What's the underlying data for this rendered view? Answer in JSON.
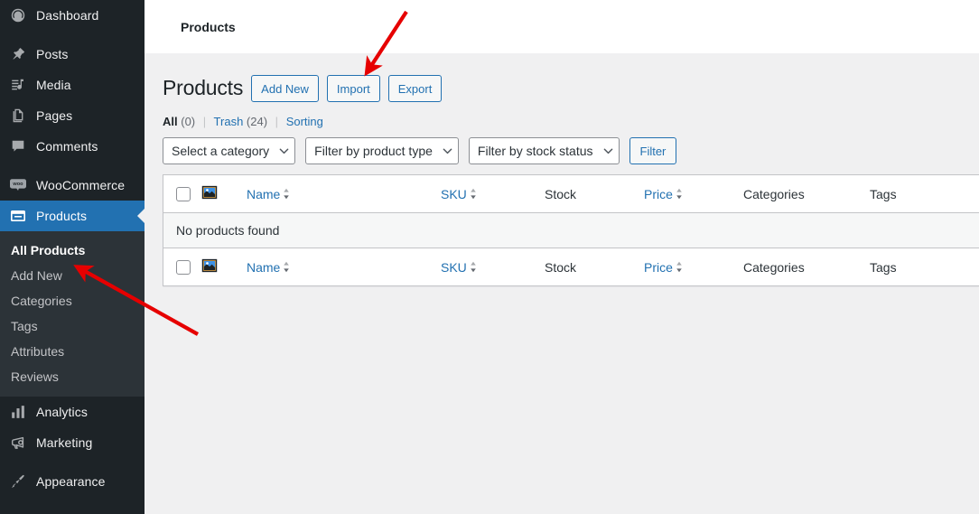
{
  "sidebar": {
    "items": [
      {
        "label": "Dashboard",
        "icon": "dashboard-icon",
        "name": "sidebar-item-dashboard",
        "current": false,
        "separator_after": true
      },
      {
        "label": "Posts",
        "icon": "pin-icon",
        "name": "sidebar-item-posts",
        "current": false,
        "separator_after": false
      },
      {
        "label": "Media",
        "icon": "media-icon",
        "name": "sidebar-item-media",
        "current": false,
        "separator_after": false
      },
      {
        "label": "Pages",
        "icon": "pages-icon",
        "name": "sidebar-item-pages",
        "current": false,
        "separator_after": false
      },
      {
        "label": "Comments",
        "icon": "comment-icon",
        "name": "sidebar-item-comments",
        "current": false,
        "separator_after": true
      },
      {
        "label": "WooCommerce",
        "icon": "woocommerce-icon",
        "name": "sidebar-item-woocommerce",
        "current": false,
        "separator_after": false
      },
      {
        "label": "Products",
        "icon": "products-icon",
        "name": "sidebar-item-products",
        "current": true,
        "separator_after": false
      }
    ],
    "submenu": [
      {
        "label": "All Products",
        "name": "submenu-item-all-products",
        "active": true
      },
      {
        "label": "Add New",
        "name": "submenu-item-add-new",
        "active": false
      },
      {
        "label": "Categories",
        "name": "submenu-item-categories",
        "active": false
      },
      {
        "label": "Tags",
        "name": "submenu-item-tags",
        "active": false
      },
      {
        "label": "Attributes",
        "name": "submenu-item-attributes",
        "active": false
      },
      {
        "label": "Reviews",
        "name": "submenu-item-reviews",
        "active": false
      }
    ],
    "items_after": [
      {
        "label": "Analytics",
        "icon": "bar-chart-icon",
        "name": "sidebar-item-analytics",
        "current": false,
        "separator_after": false
      },
      {
        "label": "Marketing",
        "icon": "megaphone-icon",
        "name": "sidebar-item-marketing",
        "current": false,
        "separator_after": true
      },
      {
        "label": "Appearance",
        "icon": "paintbrush-icon",
        "name": "sidebar-item-appearance",
        "current": false,
        "separator_after": false
      }
    ],
    "colors": {
      "background": "#1d2327",
      "submenu_background": "#2c3338",
      "current_background": "#2271b1"
    }
  },
  "topbar": {
    "breadcrumb": "Products"
  },
  "header": {
    "page_title": "Products",
    "actions": [
      {
        "label": "Add New",
        "name": "add-new-button"
      },
      {
        "label": "Import",
        "name": "import-button"
      },
      {
        "label": "Export",
        "name": "export-button"
      }
    ]
  },
  "views": {
    "all_label": "All",
    "all_count": "(0)",
    "trash_label": "Trash",
    "trash_count": "(24)",
    "sorting_label": "Sorting",
    "separator": "|"
  },
  "filters": {
    "category_select": "Select a category",
    "product_type_select": "Filter by product type",
    "stock_status_select": "Filter by stock status",
    "filter_button": "Filter"
  },
  "table": {
    "columns": [
      {
        "label": "",
        "name": "column-checkbox",
        "sortable": false,
        "type": "checkbox"
      },
      {
        "label": "",
        "name": "column-thumbnail",
        "sortable": false,
        "type": "thumbnail"
      },
      {
        "label": "Name",
        "name": "column-name",
        "sortable": true,
        "type": "text"
      },
      {
        "label": "SKU",
        "name": "column-sku",
        "sortable": true,
        "type": "text"
      },
      {
        "label": "Stock",
        "name": "column-stock",
        "sortable": false,
        "type": "text"
      },
      {
        "label": "Price",
        "name": "column-price",
        "sortable": true,
        "type": "text"
      },
      {
        "label": "Categories",
        "name": "column-categories",
        "sortable": false,
        "type": "text"
      },
      {
        "label": "Tags",
        "name": "column-tags",
        "sortable": false,
        "type": "text"
      }
    ],
    "empty_message": "No products found",
    "rows": []
  },
  "annotations": {
    "arrow_color": "#e60000",
    "arrow_to_import": "Import button",
    "arrow_to_all_products": "All Products menu item"
  }
}
